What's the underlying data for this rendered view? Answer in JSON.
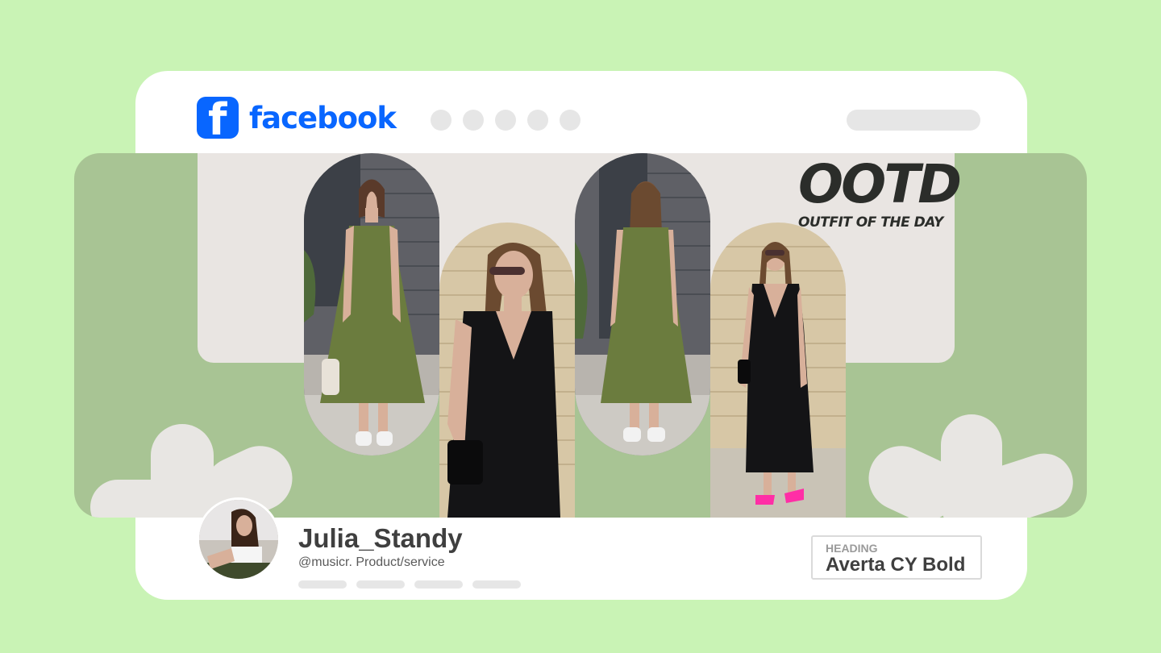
{
  "brand": {
    "name": "facebook",
    "icon_glyph": "f",
    "color": "#0866ff"
  },
  "nav": {
    "placeholder_dots": 5
  },
  "cover": {
    "ootd_title": "OOTD",
    "ootd_subtitle": "OUTFIT OF THE DAY",
    "background_color": "#a8c494",
    "panel_color": "#e9e5e2"
  },
  "profile": {
    "name": "Julia_Standy",
    "handle": "@musicr. Product/service"
  },
  "font_info": {
    "label": "HEADING",
    "value": "Averta CY Bold"
  },
  "colors": {
    "page_background": "#c9f3b5",
    "card_background": "#ffffff",
    "placeholder_gray": "#e6e6e6",
    "text_dark": "#3f3f3f"
  }
}
